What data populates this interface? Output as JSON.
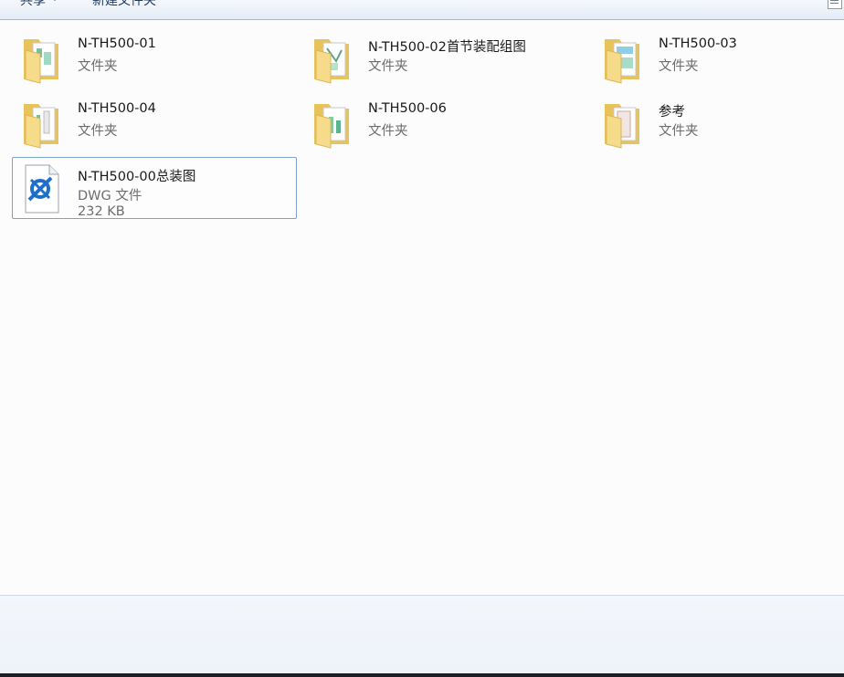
{
  "toolbar": {
    "share_label": "共享",
    "new_folder_label": "新建文件夹",
    "view_icon": "view-options-icon"
  },
  "items": [
    {
      "name": "N-TH500-01",
      "type": "文件夹",
      "icon": "folder-icon"
    },
    {
      "name": "N-TH500-02首节装配组图",
      "type": "文件夹",
      "icon": "folder-icon"
    },
    {
      "name": "N-TH500-03",
      "type": "文件夹",
      "icon": "folder-icon"
    },
    {
      "name": "N-TH500-04",
      "type": "文件夹",
      "icon": "folder-icon"
    },
    {
      "name": "N-TH500-06",
      "type": "文件夹",
      "icon": "folder-icon"
    },
    {
      "name": "参考",
      "type": "文件夹",
      "icon": "folder-icon"
    },
    {
      "name": "N-TH500-00总装图",
      "type": "DWG 文件",
      "size": "232 KB",
      "icon": "dwg-file-icon",
      "selected": true
    }
  ],
  "colors": {
    "selection_border": "#7da2ce",
    "folder_yellow": "#f3d57a",
    "dwg_blue": "#1f6fc9"
  }
}
